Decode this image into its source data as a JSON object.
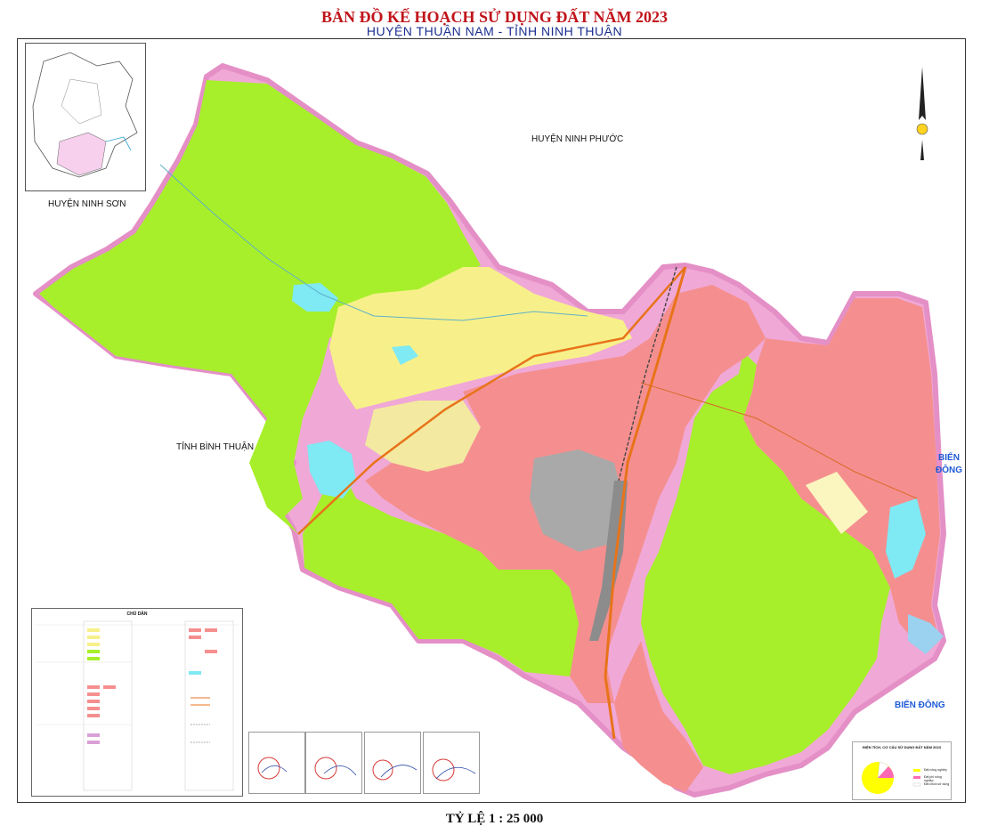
{
  "title": "BẢN ĐỒ KẾ HOẠCH SỬ DỤNG ĐẤT NĂM 2023",
  "subtitle": "HUYỆN THUẬN NAM - TỈNH NINH THUẬN",
  "place_labels": {
    "ninh_phuoc": "HUYỆN NINH PHƯỚC",
    "ninh_son": "HUYỆN NINH SƠN",
    "binh_thuan": "TỈNH BÌNH THUẬN",
    "bien_dong_1": "BIỂN\nĐÔNG",
    "bien_dong_2": "BIỂN ĐÔNG"
  },
  "legend": {
    "title": "CHÚ DẪN"
  },
  "scale": "TỶ LỆ 1 : 25 000",
  "pie_chart": {
    "title": "ĐIỆN TÍCH, CƠ CẤU SỬ DỤNG ĐẤT NĂM 2023",
    "labels": [
      "Đất nông nghiệp",
      "Đất phi nông nghiệp",
      "Đất chưa sử dụng"
    ],
    "colors": [
      "#ffff00",
      "#ff69b4",
      "#ffffff"
    ]
  },
  "colors": {
    "forest": "#a7ef2a",
    "urban": "#f58f8f",
    "agri": "#f7f08a",
    "water": "#7fe9f4",
    "industrial": "#a9a9a9",
    "boundary": "#f0a8d6",
    "road": "#e8731a"
  }
}
